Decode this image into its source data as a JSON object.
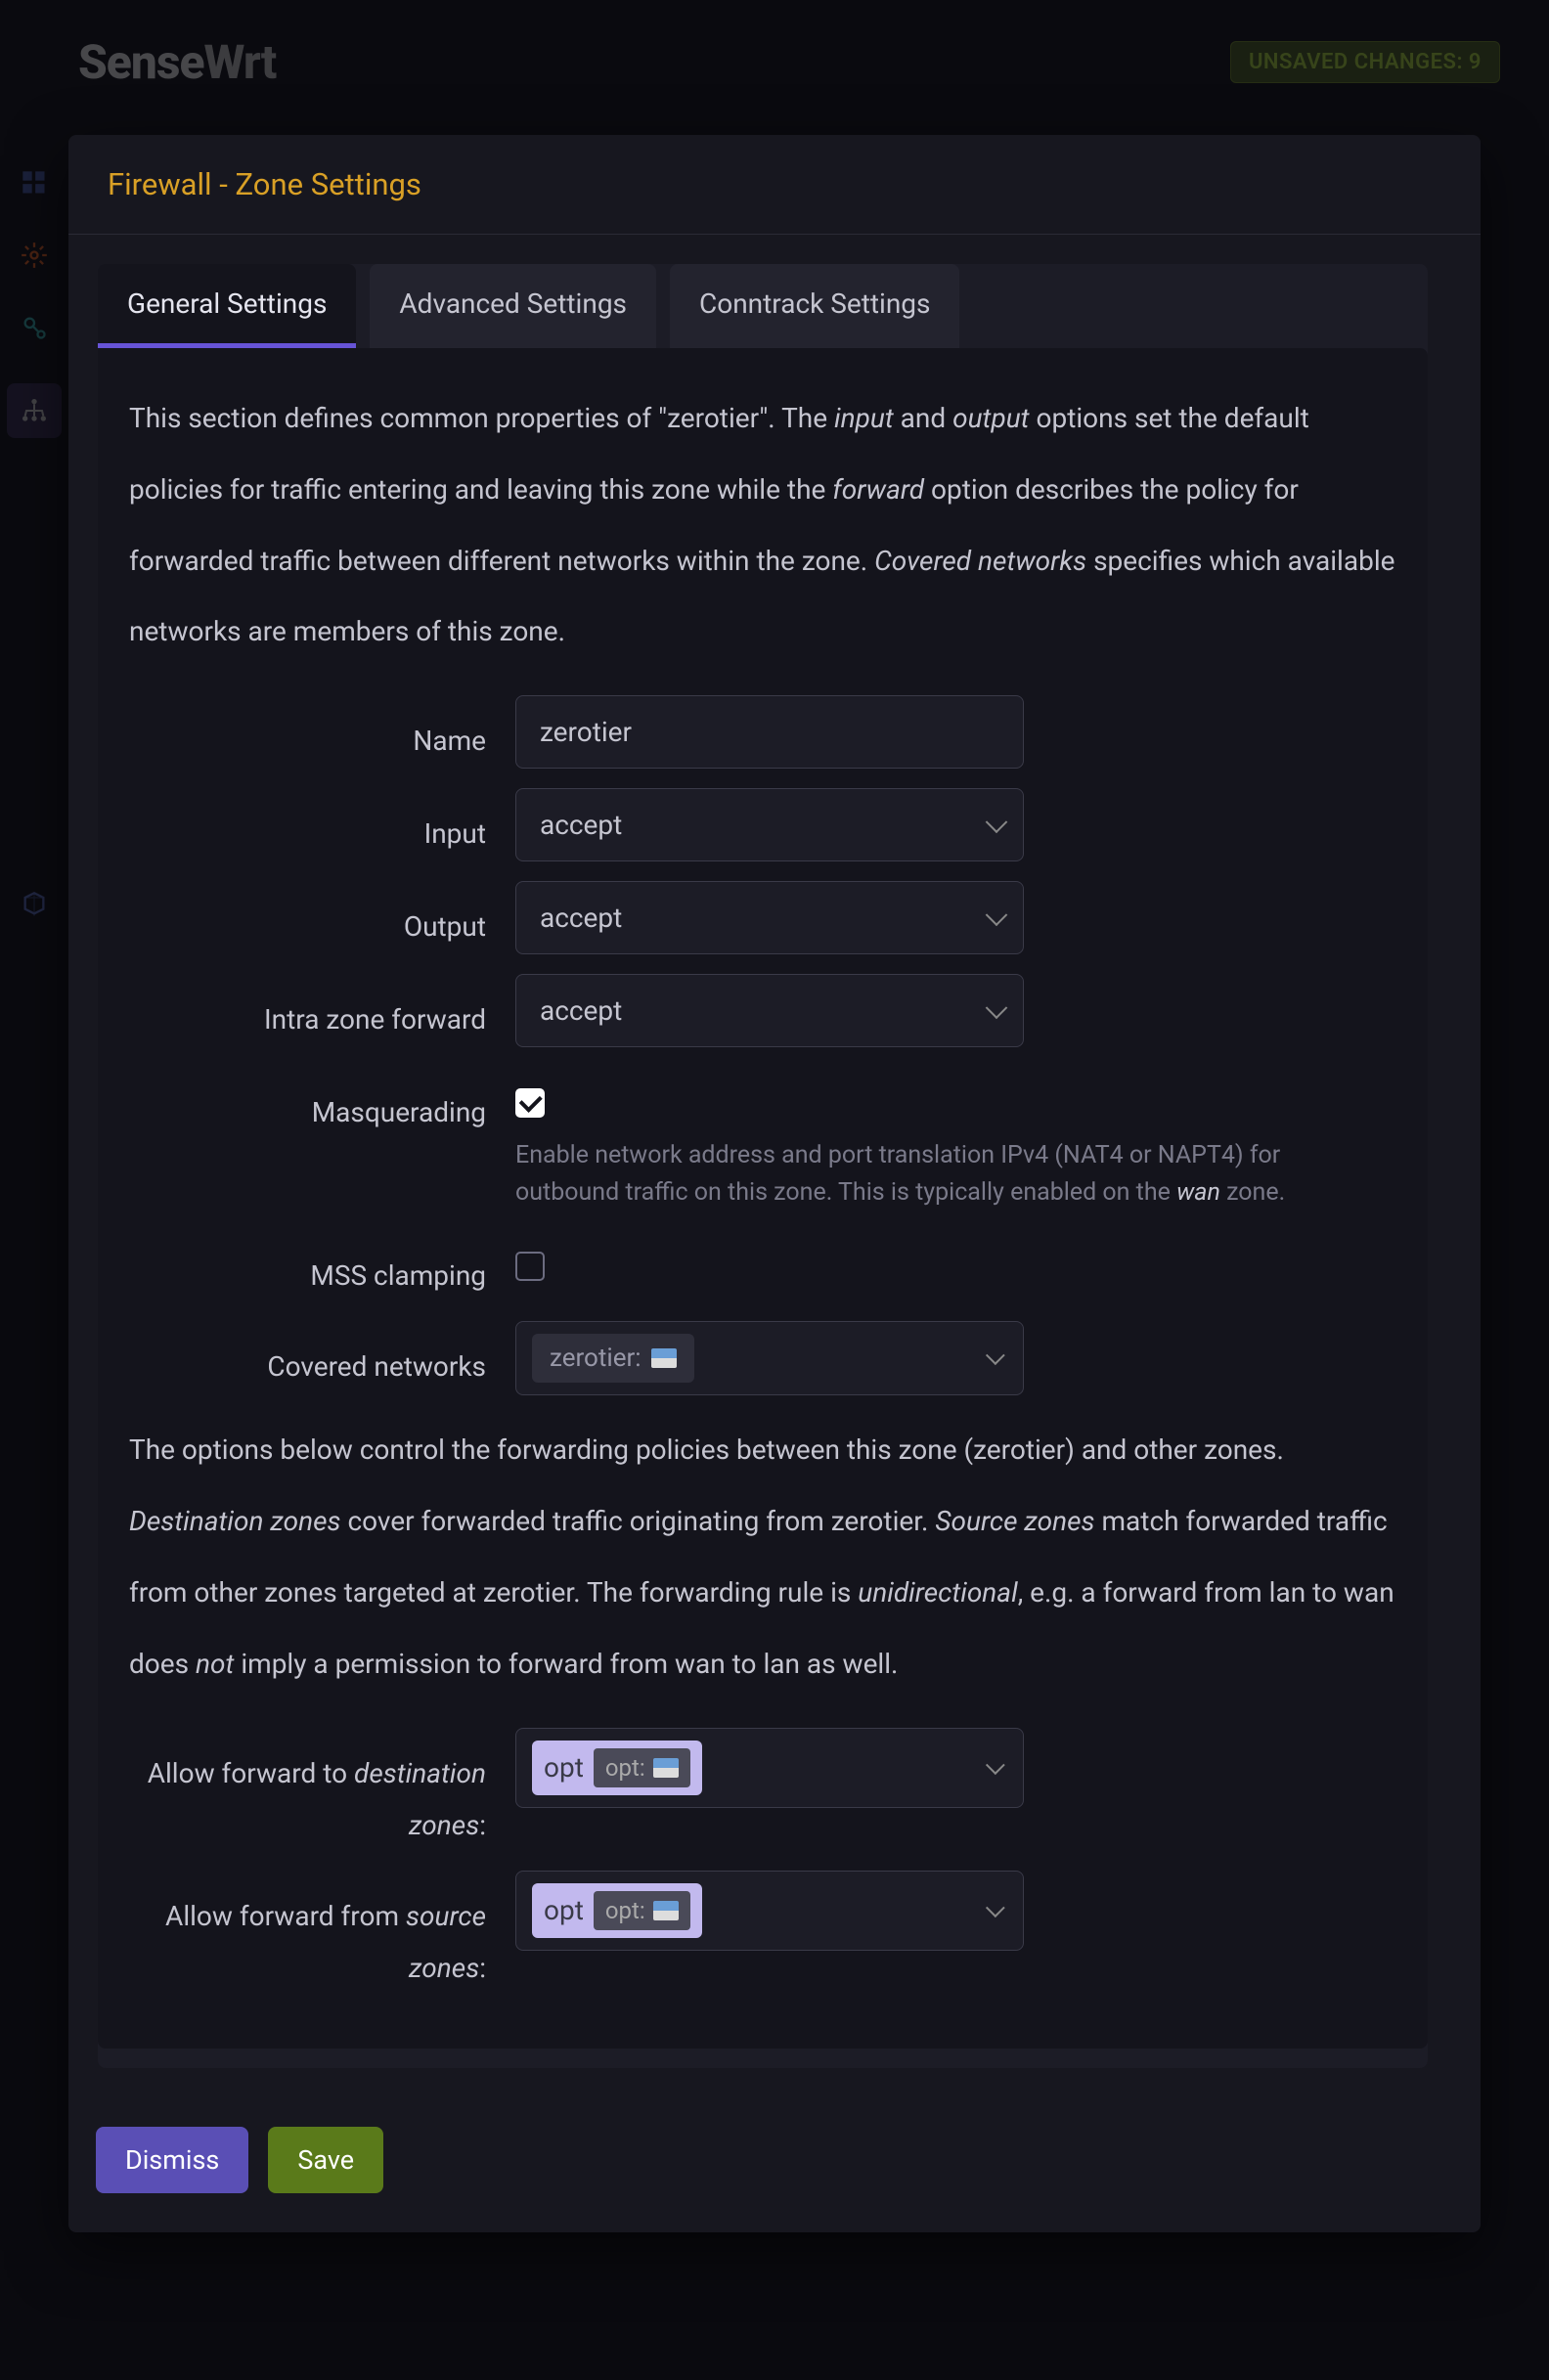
{
  "header": {
    "logo_bold": "Sense",
    "logo_rest": "Wrt",
    "unsaved_label": "UNSAVED CHANGES: 9"
  },
  "sidebar": {
    "icons": [
      "dashboard",
      "gear",
      "processes",
      "network",
      "cube"
    ]
  },
  "modal": {
    "title": "Firewall - Zone Settings",
    "tabs": {
      "general": "General Settings",
      "advanced": "Advanced Settings",
      "conntrack": "Conntrack Settings"
    },
    "desc1_a": "This section defines common properties of \"zerotier\". The ",
    "desc1_b": " and ",
    "desc1_c": " options set the default policies for traffic entering and leaving this zone while the ",
    "desc1_d": " option describes the policy for forwarded traffic between different networks within the zone. ",
    "desc1_e": " specifies which available networks are members of this zone.",
    "em_input": "input",
    "em_output": "output",
    "em_forward": "forward",
    "em_covered": "Covered networks",
    "fields": {
      "name_label": "Name",
      "name_value": "zerotier",
      "input_label": "Input",
      "input_value": "accept",
      "output_label": "Output",
      "output_value": "accept",
      "intra_label": "Intra zone forward",
      "intra_value": "accept",
      "masq_label": "Masquerading",
      "masq_hint_a": "Enable network address and port translation IPv4 (NAT4 or NAPT4) for outbound traffic on this zone. This is typically enabled on the ",
      "masq_hint_b": " zone.",
      "em_wan": "wan",
      "mss_label": "MSS clamping",
      "covered_label": "Covered networks",
      "covered_chip": "zerotier:"
    },
    "desc2_a": "The options below control the forwarding policies between this zone (zerotier) and other zones. ",
    "desc2_b": " cover forwarded traffic originating from zerotier. ",
    "desc2_c": " match forwarded traffic from other zones targeted at zerotier. The forwarding rule is ",
    "desc2_d": ", e.g. a forward from lan to wan does ",
    "desc2_e": " imply a permission to forward from wan to lan as well.",
    "em_destzones": "Destination zones",
    "em_srczones": "Source zones",
    "em_unidir": "unidirectional",
    "em_not": "not",
    "fwd": {
      "dest_label_a": "Allow forward to ",
      "dest_label_b": "destination zones",
      "dest_label_c": ":",
      "src_label_a": "Allow forward from ",
      "src_label_b": "source zones",
      "src_label_c": ":",
      "badge_text": "opt",
      "chip_text": "opt:"
    },
    "footer": {
      "dismiss": "Dismiss",
      "save": "Save"
    }
  }
}
